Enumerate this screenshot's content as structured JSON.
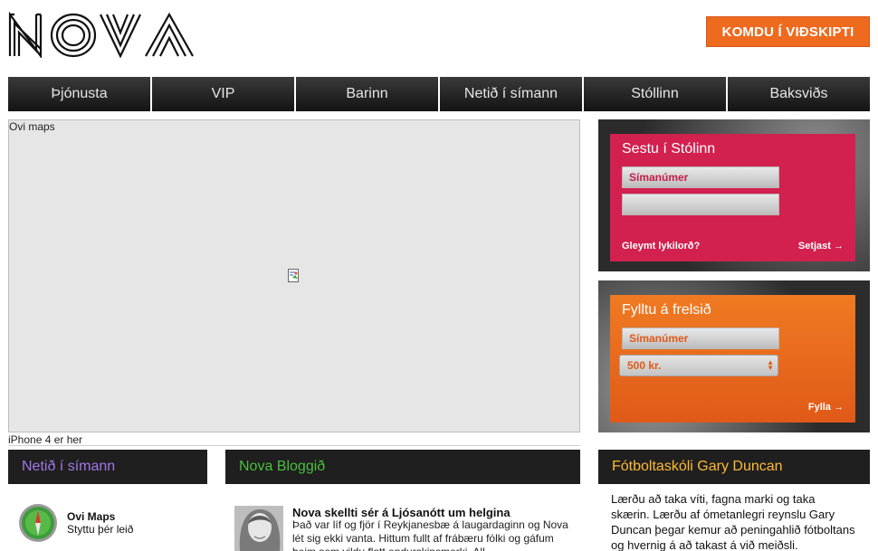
{
  "header": {
    "logo_text": "NOVA",
    "cta_label": "KOMDU Í VIÐSKIPTI"
  },
  "nav": {
    "items": [
      "Þjónusta",
      "VIP",
      "Barinn",
      "Netið í símann",
      "Stóllinn",
      "Baksviðs"
    ]
  },
  "map": {
    "label": "Ovi maps",
    "caption": "iPhone 4 er her"
  },
  "login_panel": {
    "title": "Sestu í Stólinn",
    "phone_placeholder": "Símanúmer",
    "password_value": "",
    "forgot_label": "Gleymt lykilorð?",
    "submit_label": "Setjast",
    "arrow": "→"
  },
  "topup_panel": {
    "title": "Fylltu á frelsið",
    "phone_placeholder": "Símanúmer",
    "amount_selected": "500 kr.",
    "submit_label": "Fylla",
    "arrow": "→"
  },
  "sections": {
    "netid": {
      "title": "Netið í símann",
      "app_name": "Ovi Maps",
      "app_desc": "Styttu þér leið"
    },
    "blog": {
      "title": "Nova Bloggið",
      "post_title": "Nova skellti sér á Ljósanótt um helgina",
      "post_body": "Það var líf og fjör í Reykjanesbæ á laugardaginn og Nova lét sig ekki vanta. Hittum fullt af frábæru fólki og gáfum þeim sem vildu flott endurskinsmerki. All"
    },
    "football": {
      "title": "Fótboltaskóli Gary Duncan",
      "body": "Lærðu að taka víti, fagna marki og taka skærin. Lærðu af ómetanlegri reynslu Gary Duncan þegar kemur að peningahlið fótboltans og hvernig á að takast á við meiðsli."
    }
  },
  "colors": {
    "accent_orange": "#ee6a1f",
    "login_red": "#d2214f",
    "purple_heading": "#a277e8",
    "green_heading": "#4bbf3f",
    "yellow_heading": "#ffbb33"
  }
}
